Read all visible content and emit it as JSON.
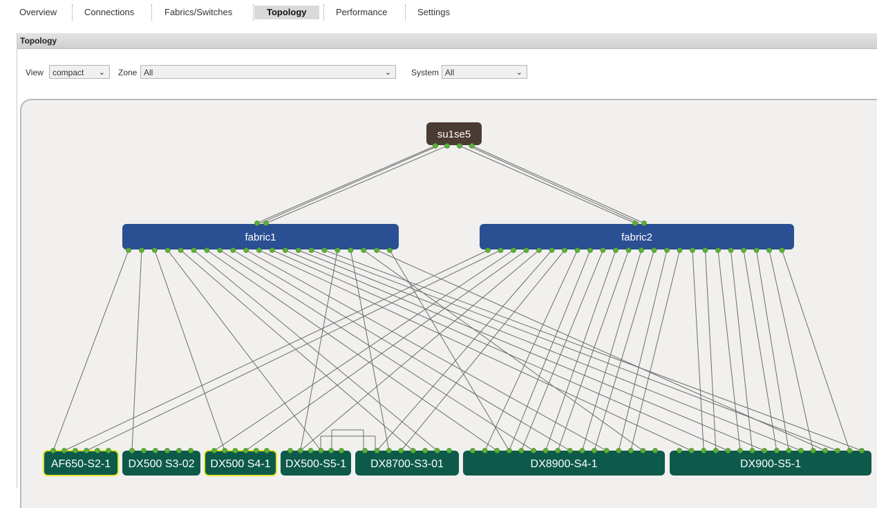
{
  "tabs": [
    {
      "label": "Overview",
      "active": false
    },
    {
      "label": "Connections",
      "active": false
    },
    {
      "label": "Fabrics/Switches",
      "active": false
    },
    {
      "label": "Topology",
      "active": true
    },
    {
      "label": "Performance",
      "active": false
    },
    {
      "label": "Settings",
      "active": false
    }
  ],
  "section": {
    "title": "Topology"
  },
  "filters": {
    "view": {
      "label": "View",
      "value": "compact"
    },
    "zone": {
      "label": "Zone",
      "value": "All"
    },
    "system": {
      "label": "System",
      "value": "All"
    }
  },
  "topology": {
    "root": {
      "label": "su1se5",
      "color": "#4a3b33"
    },
    "fabrics": [
      {
        "label": "fabric1",
        "color": "#2a4f92"
      },
      {
        "label": "fabric2",
        "color": "#2a4f92"
      }
    ],
    "storage": [
      {
        "label": "AF650-S2-1",
        "highlighted": true
      },
      {
        "label": "DX500 S3-02",
        "highlighted": false
      },
      {
        "label": "DX500 S4-1",
        "highlighted": true
      },
      {
        "label": "DX500-S5-1",
        "highlighted": false
      },
      {
        "label": "DX8700-S3-01",
        "highlighted": false
      },
      {
        "label": "DX8900-S4-1",
        "highlighted": false
      },
      {
        "label": "DX900-S5-1",
        "highlighted": false
      }
    ],
    "colors": {
      "storage_fill": "#0d5a4b",
      "highlight_border": "#e6e62a",
      "port": "#5dae3a",
      "link": "#6b6b6b",
      "canvas": "#f1f0ee"
    }
  }
}
